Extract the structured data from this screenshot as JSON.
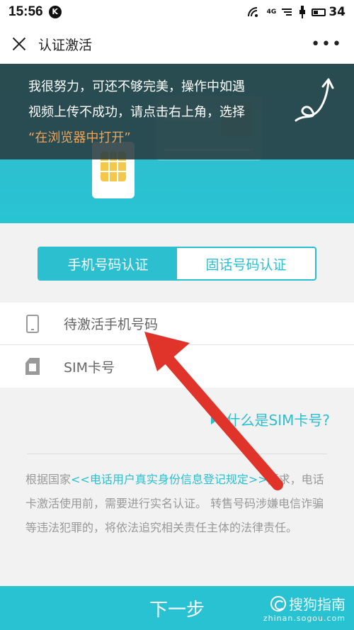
{
  "status_bar": {
    "time": "15:56",
    "k_badge": "K",
    "network": "4G",
    "battery": "34"
  },
  "title_bar": {
    "title": "认证激活",
    "more": "•••"
  },
  "banner": {
    "overlay_line1": "我很努力，可还不够完美，操作中如遇",
    "overlay_line2": "视频上传不成功，请点击右上角，选择",
    "overlay_line3": "“在浏览器中打开”"
  },
  "tabs": [
    {
      "label": "手机号码认证",
      "active": true
    },
    {
      "label": "固话号码认证",
      "active": false
    }
  ],
  "form": {
    "phone_placeholder": "待激活手机号码",
    "sim_placeholder": "SIM卡号"
  },
  "help": {
    "label": "什么是SIM卡号?"
  },
  "notice": {
    "prefix": "根据国家",
    "link": "<<电话用户真实身份信息登记规定>>",
    "rest": "要求，电话卡激活使用前，需要进行实名认证。 转售号码涉嫌电信诈骗等违法犯罪的，将依法追究相关责任主体的法律责任。"
  },
  "next_button": {
    "label": "下一步"
  },
  "watermark": {
    "brand": "搜狗指南",
    "url": "zhinan.sogou.com"
  },
  "colors": {
    "accent": "#2bbfcf",
    "overlay": "#283c40",
    "highlight_text": "#f0a35a",
    "annotation_arrow": "#e0342b"
  }
}
